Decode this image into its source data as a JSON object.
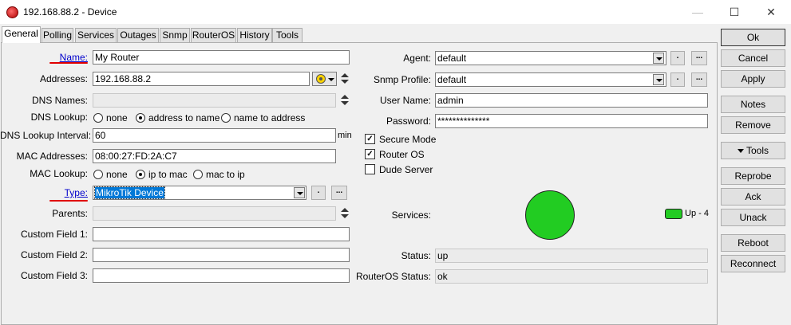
{
  "window": {
    "title": "192.168.88.2 - Device",
    "min": "—",
    "max": "☐",
    "close": "✕"
  },
  "tabs": [
    "General",
    "Polling",
    "Services",
    "Outages",
    "Snmp",
    "RouterOS",
    "History",
    "Tools"
  ],
  "left": {
    "name_label": "Name:",
    "name_value": "My Router",
    "addresses_label": "Addresses:",
    "addresses_value": "192.168.88.2",
    "dns_names_label": "DNS Names:",
    "dns_lookup_label": "DNS Lookup:",
    "dns_lookup_options": [
      "none",
      "address to name",
      "name to address"
    ],
    "dns_interval_label": "DNS Lookup Interval:",
    "dns_interval_value": "60",
    "dns_interval_unit": "min",
    "mac_addresses_label": "MAC Addresses:",
    "mac_addresses_value": "08:00:27:FD:2A:C7",
    "mac_lookup_label": "MAC Lookup:",
    "mac_lookup_options": [
      "none",
      "ip to mac",
      "mac to ip"
    ],
    "type_label": "Type:",
    "type_value": "MikroTik Device",
    "parents_label": "Parents:",
    "custom1_label": "Custom Field 1:",
    "custom1_value": "",
    "custom2_label": "Custom Field 2:",
    "custom2_value": "",
    "custom3_label": "Custom Field 3:",
    "custom3_value": ""
  },
  "right": {
    "agent_label": "Agent:",
    "agent_value": "default",
    "snmp_label": "Snmp Profile:",
    "snmp_value": "default",
    "username_label": "User Name:",
    "username_value": "admin",
    "password_label": "Password:",
    "password_value": "**************",
    "secure_mode": "Secure Mode",
    "router_os": "Router OS",
    "dude_server": "Dude Server",
    "services_label": "Services:",
    "services_legend": "Up - 4",
    "status_label": "Status:",
    "status_value": "up",
    "ros_status_label": "RouterOS Status:",
    "ros_status_value": "ok"
  },
  "buttons": {
    "ok": "Ok",
    "cancel": "Cancel",
    "apply": "Apply",
    "notes": "Notes",
    "remove": "Remove",
    "tools": "Tools",
    "reprobe": "Reprobe",
    "ack": "Ack",
    "unack": "Unack",
    "reboot": "Reboot",
    "reconnect": "Reconnect",
    "small_dot": ".",
    "small_ellipsis": "..."
  },
  "colors": {
    "service_up": "#22cc22",
    "selection": "#0078d7",
    "link": "#0000cc",
    "annotation": "#e00000"
  }
}
